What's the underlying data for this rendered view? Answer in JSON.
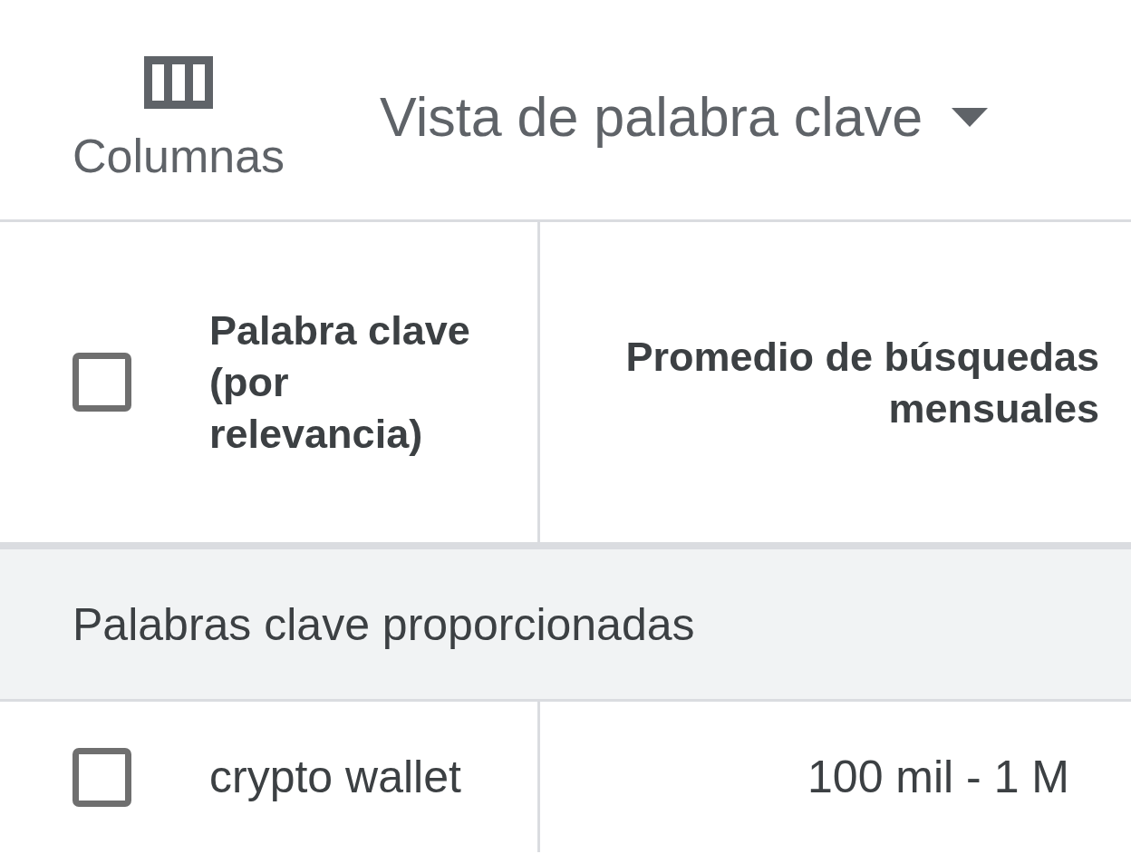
{
  "toolbar": {
    "columns_button": {
      "label": "Columnas"
    },
    "view_dropdown": {
      "label": "Vista de palabra clave"
    }
  },
  "table": {
    "select_all": {
      "checked": false
    },
    "columns": [
      "Palabra clave (por relevancia)",
      "Promedio de búsquedas mensuales"
    ],
    "groups": [
      {
        "label": "Palabras clave proporcionadas",
        "rows": [
          {
            "checked": false,
            "keyword": "crypto wallet",
            "avg_monthly_searches": "100 mil - 1 M"
          }
        ]
      }
    ]
  }
}
